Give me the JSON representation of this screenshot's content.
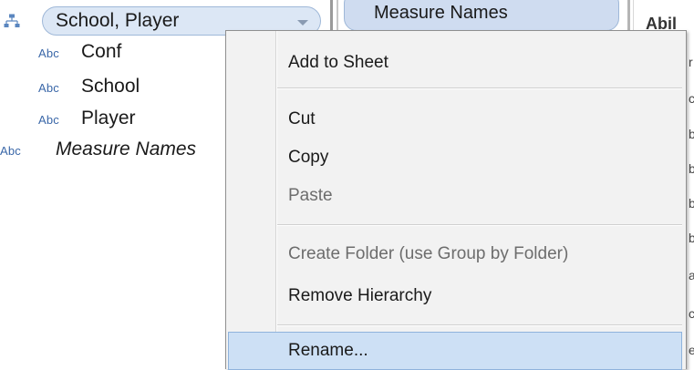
{
  "data_pane": {
    "hierarchy": {
      "icon": "hierarchy-icon",
      "label": "School, Player",
      "caret_icon": "chevron-down-icon"
    },
    "fields": [
      {
        "type": "Abc",
        "name": "Conf"
      },
      {
        "type": "Abc",
        "name": "School"
      },
      {
        "type": "Abc",
        "name": "Player"
      },
      {
        "type": "Abc",
        "name": "Measure Names"
      }
    ]
  },
  "shelf": {
    "pill_label": "Measure Names"
  },
  "view": {
    "column_header": "Abil",
    "slivers": [
      "r",
      "c",
      "b",
      "b",
      "b",
      "b",
      "a",
      "c",
      "e"
    ]
  },
  "context_menu": {
    "items": [
      {
        "label": "Add to Sheet",
        "enabled": true
      },
      {
        "label": "Cut",
        "enabled": true
      },
      {
        "label": "Copy",
        "enabled": true
      },
      {
        "label": "Paste",
        "enabled": false
      },
      {
        "label": "Create Folder (use Group by Folder)",
        "enabled": false
      },
      {
        "label": "Remove Hierarchy",
        "enabled": true
      },
      {
        "label": "Rename...",
        "enabled": true,
        "hovered": true
      }
    ]
  },
  "colors": {
    "pill_fill": "#dce7f5",
    "pill_border": "#9fb8d8",
    "type_text": "#3a67a8",
    "menu_bg": "#f2f2f2",
    "menu_hover": "#cde0f5"
  }
}
